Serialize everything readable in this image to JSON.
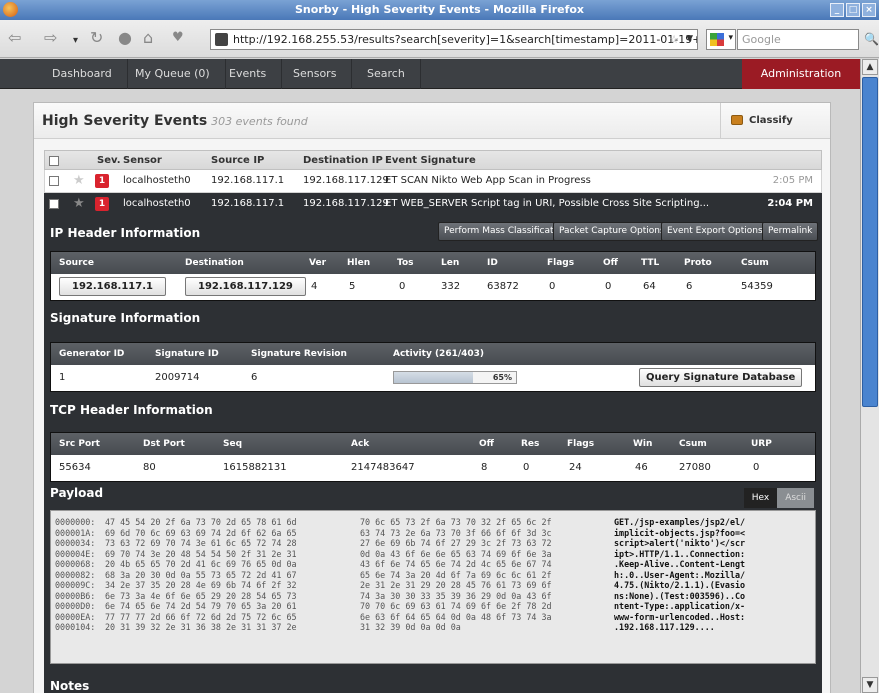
{
  "window": {
    "title": "Snorby - High Severity Events - Mozilla Firefox",
    "buttons": [
      "_",
      "□",
      "×"
    ]
  },
  "browser": {
    "url": "http://192.168.255.53/results?search[severity]=1&search[timestamp]=2011-01-19+-+",
    "search_placeholder": "Google"
  },
  "nav": {
    "items": [
      "Dashboard",
      "My Queue (0)",
      "Events",
      "Sensors",
      "Search"
    ],
    "admin": "Administration"
  },
  "page": {
    "title": "High Severity Events",
    "count": "303 events found",
    "classify_button": "Classify Event(s)"
  },
  "events": {
    "headers": {
      "sev": "Sev.",
      "sensor": "Sensor",
      "src": "Source IP",
      "dst": "Destination IP",
      "sig": "Event Signature"
    },
    "rows": [
      {
        "sev": "1",
        "sensor": "localhosteth0",
        "src": "192.168.117.1",
        "dst": "192.168.117.129",
        "sig": "ET SCAN Nikto Web App Scan in Progress",
        "time": "2:05 PM"
      },
      {
        "sev": "1",
        "sensor": "localhosteth0",
        "src": "192.168.117.1",
        "dst": "192.168.117.129",
        "sig": "ET WEB_SERVER Script tag in URI, Possible Cross Site Scripting...",
        "time": "2:04 PM"
      }
    ]
  },
  "ip_header": {
    "title": "IP Header Information",
    "buttons": [
      "Perform Mass Classification",
      "Packet Capture Options",
      "Event Export Options",
      "Permalink"
    ],
    "cols": [
      "Source",
      "Destination",
      "Ver",
      "Hlen",
      "Tos",
      "Len",
      "ID",
      "Flags",
      "Off",
      "TTL",
      "Proto",
      "Csum"
    ],
    "values": [
      "192.168.117.1",
      "192.168.117.129",
      "4",
      "5",
      "0",
      "332",
      "63872",
      "0",
      "0",
      "64",
      "6",
      "54359"
    ]
  },
  "signature": {
    "title": "Signature Information",
    "cols": [
      "Generator ID",
      "Signature ID",
      "Signature Revision",
      "Activity (261/403)"
    ],
    "values": [
      "1",
      "2009714",
      "6"
    ],
    "activity_percent": 65,
    "activity_label": "65%",
    "query_button": "Query Signature Database"
  },
  "tcp_header": {
    "title": "TCP Header Information",
    "cols": [
      "Src Port",
      "Dst Port",
      "Seq",
      "Ack",
      "Off",
      "Res",
      "Flags",
      "Win",
      "Csum",
      "URP"
    ],
    "values": [
      "55634",
      "80",
      "1615882131",
      "2147483647",
      "8",
      "0",
      "24",
      "46",
      "27080",
      "0"
    ]
  },
  "payload": {
    "title": "Payload",
    "tabs": [
      "Hex",
      "Ascii"
    ],
    "rows": [
      {
        "off": "0000000:",
        "h1": "47 45 54 20 2f 6a 73 70 2d 65 78 61 6d",
        "h2": "70 6c 65 73 2f 6a 73 70 32 2f 65 6c 2f",
        "asc": "GET./jsp-examples/jsp2/el/"
      },
      {
        "off": "000001A:",
        "h1": "69 6d 70 6c 69 63 69 74 2d 6f 62 6a 65",
        "h2": "63 74 73 2e 6a 73 70 3f 66 6f 6f 3d 3c",
        "asc": "implicit-objects.jsp?foo=<"
      },
      {
        "off": "0000034:",
        "h1": "73 63 72 69 70 74 3e 61 6c 65 72 74 28",
        "h2": "27 6e 69 6b 74 6f 27 29 3c 2f 73 63 72",
        "asc": "script>alert('nikto')</scr"
      },
      {
        "off": "000004E:",
        "h1": "69 70 74 3e 20 48 54 54 50 2f 31 2e 31",
        "h2": "0d 0a 43 6f 6e 6e 65 63 74 69 6f 6e 3a",
        "asc": "ipt>.HTTP/1.1..Connection:"
      },
      {
        "off": "0000068:",
        "h1": "20 4b 65 65 70 2d 41 6c 69 76 65 0d 0a",
        "h2": "43 6f 6e 74 65 6e 74 2d 4c 65 6e 67 74",
        "asc": ".Keep-Alive..Content-Lengt"
      },
      {
        "off": "0000082:",
        "h1": "68 3a 20 30 0d 0a 55 73 65 72 2d 41 67",
        "h2": "65 6e 74 3a 20 4d 6f 7a 69 6c 6c 61 2f",
        "asc": "h:.0..User-Agent:.Mozilla/"
      },
      {
        "off": "000009C:",
        "h1": "34 2e 37 35 20 28 4e 69 6b 74 6f 2f 32",
        "h2": "2e 31 2e 31 29 20 28 45 76 61 73 69 6f",
        "asc": "4.75.(Nikto/2.1.1).(Evasio"
      },
      {
        "off": "00000B6:",
        "h1": "6e 73 3a 4e 6f 6e 65 29 20 28 54 65 73",
        "h2": "74 3a 30 30 33 35 39 36 29 0d 0a 43 6f",
        "asc": "ns:None).(Test:003596)..Co"
      },
      {
        "off": "00000D0:",
        "h1": "6e 74 65 6e 74 2d 54 79 70 65 3a 20 61",
        "h2": "70 70 6c 69 63 61 74 69 6f 6e 2f 78 2d",
        "asc": "ntent-Type:.application/x-"
      },
      {
        "off": "00000EA:",
        "h1": "77 77 77 2d 66 6f 72 6d 2d 75 72 6c 65",
        "h2": "6e 63 6f 64 65 64 0d 0a 48 6f 73 74 3a",
        "asc": "www-form-urlencoded..Host:"
      },
      {
        "off": "0000104:",
        "h1": "20 31 39 32 2e 31 36 38 2e 31 31 37 2e",
        "h2": "31 32 39 0d 0a 0d 0a",
        "asc": ".192.168.117.129...."
      }
    ]
  },
  "notes": {
    "title": "Notes"
  }
}
